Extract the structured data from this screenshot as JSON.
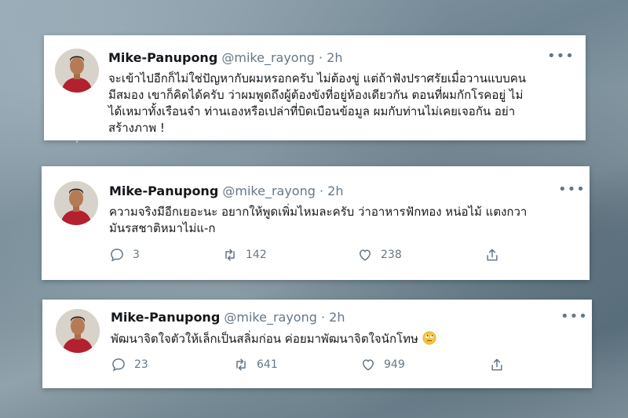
{
  "colors": {
    "text": "#14171a",
    "secondary": "#657786",
    "card_bg": "#ffffff",
    "thread_line": "#cdd6dd"
  },
  "tweets": [
    {
      "author": "Mike-Panupong",
      "handle": "@mike_rayong",
      "dot": "·",
      "time": "2h",
      "more_icon": "more-options-icon",
      "lines": [
        "จะเข้าไปอีกก็ไม่ใช่ปัญหากับผมหรอกครับ ไม่ต้องขู่ แต่ถ้าฟังปราศรัยเมื่อวานแบบคน",
        "มีสมอง เขาก็คิดได้ครับ ว่าผมพูดถึงผู้ต้องขังที่อยู่ห้องเดียวกัน ตอนที่ผมกักโรคอยู่ ไม่",
        "ได้เหมาทั้งเรือนจำ ท่านเองหรือเปล่าที่บิดเบือนข้อมูล ผมกับท่านไม่เคยเจอกัน  อย่า",
        "สร้างภาพ !"
      ]
    },
    {
      "author": "Mike-Panupong",
      "handle": "@mike_rayong",
      "dot": "·",
      "time": "2h",
      "more_icon": "more-options-icon",
      "lines": [
        "ความจริงมีอีกเยอะนะ อยากให้พูดเพิ่มไหมละครับ ว่าอาหารฟักทอง หน่อไม้ แตงกวา",
        "มันรสชาติหมาไม่แ-ก"
      ],
      "replies": "3",
      "retweets": "142",
      "likes": "238"
    },
    {
      "author": "Mike-Panupong",
      "handle": "@mike_rayong",
      "dot": "·",
      "time": "2h",
      "more_icon": "more-options-icon",
      "lines": [
        "พัฒนาจิตใจตัวให้เล็กเป็นสลิ่มก่อน ค่อยมาพัฒนาจิตใจนักโทษ"
      ],
      "emoji": "face-with-rolling-eyes-emoji",
      "replies": "23",
      "retweets": "641",
      "likes": "949"
    }
  ]
}
